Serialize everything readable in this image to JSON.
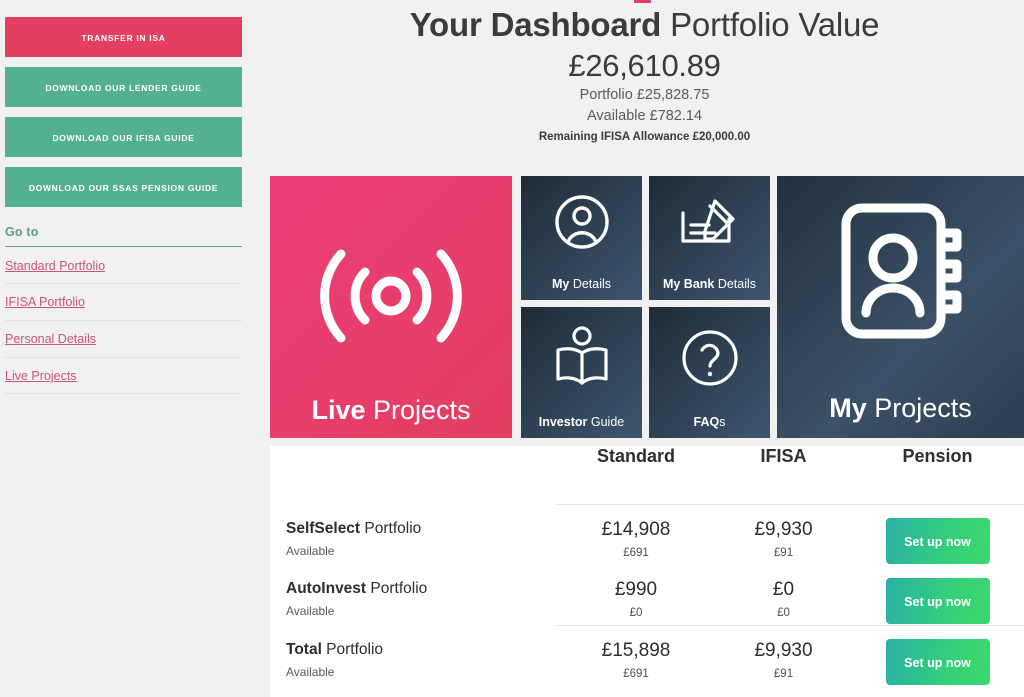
{
  "theme": {
    "page_bg": "#f1f1f1",
    "pink": "#e23f61",
    "green": "#54b190",
    "link_pink": "#cb5572",
    "goto_green": "#5f9e83",
    "tile_dark_start": "#1f2c37",
    "tile_dark_end": "#3d5670",
    "setup_gradient_start": "#28b0a5",
    "setup_gradient_end": "#3ad96a"
  },
  "sidebar": {
    "buttons": [
      {
        "label": "TRANSFER IN ISA",
        "style": "pink",
        "icon": "transfer-isa-button"
      },
      {
        "label": "DOWNLOAD OUR LENDER GUIDE",
        "style": "green",
        "icon": "download-lender-guide-button"
      },
      {
        "label": "DOWNLOAD OUR IFISA GUIDE",
        "style": "green",
        "icon": "download-ifisa-guide-button"
      },
      {
        "label": "DOWNLOAD OUR SSAS PENSION GUIDE",
        "style": "green",
        "icon": "download-ssas-guide-button"
      }
    ],
    "goto_label": "Go to",
    "links": [
      {
        "label": "Standard Portfolio"
      },
      {
        "label": "IFISA Portfolio"
      },
      {
        "label": "Personal Details"
      },
      {
        "label": "Live Projects"
      }
    ]
  },
  "header": {
    "title_bold": "Your Dashboard",
    "title_rest": " Portfolio Value",
    "total_value": "£26,610.89",
    "portfolio_line": "Portfolio £25,828.75",
    "available_line": "Available £782.14",
    "remaining_line": "Remaining IFISA Allowance £20,000.00"
  },
  "tiles": [
    {
      "id": "live-projects",
      "icon": "broadcast-signal-icon",
      "label_bold": "Live",
      "label_rest": " Projects",
      "color": "#e33f60"
    },
    {
      "id": "my-details",
      "icon": "user-circle-icon",
      "label_bold": "My",
      "label_rest": " Details",
      "color": "#2b3c4b"
    },
    {
      "id": "my-bank-details",
      "icon": "cheque-pen-icon",
      "label_bold": "My Bank",
      "label_rest": " Details",
      "color": "#2b3c4b"
    },
    {
      "id": "investor-guide",
      "icon": "open-book-person-icon",
      "label_bold": "Investor",
      "label_rest": " Guide",
      "color": "#2b3c4b"
    },
    {
      "id": "faqs",
      "icon": "question-mark-circle-icon",
      "label_bold": "FAQ",
      "label_rest": "s",
      "color": "#2b3c4b"
    },
    {
      "id": "my-projects",
      "icon": "address-book-icon",
      "label_bold": "My",
      "label_rest": " Projects",
      "color": "#2c3f51"
    }
  ],
  "table": {
    "headers": {
      "name": "",
      "standard": "Standard",
      "ifisa": "IFISA",
      "pension": "Pension"
    },
    "rows": [
      {
        "title_bold": "SelfSelect",
        "title_rest": " Portfolio",
        "available_label": "Available",
        "standard_value": "£14,908",
        "standard_available": "£691",
        "ifisa_value": "£9,930",
        "ifisa_available": "£91",
        "pension_button": "Set up now"
      },
      {
        "title_bold": "AutoInvest",
        "title_rest": " Portfolio",
        "available_label": "Available",
        "standard_value": "£990",
        "standard_available": "£0",
        "ifisa_value": "£0",
        "ifisa_available": "£0",
        "pension_button": "Set up now"
      },
      {
        "title_bold": "Total",
        "title_rest": " Portfolio",
        "available_label": "Available",
        "standard_value": "£15,898",
        "standard_available": "£691",
        "ifisa_value": "£9,930",
        "ifisa_available": "£91",
        "pension_button": "Set up now"
      }
    ]
  }
}
